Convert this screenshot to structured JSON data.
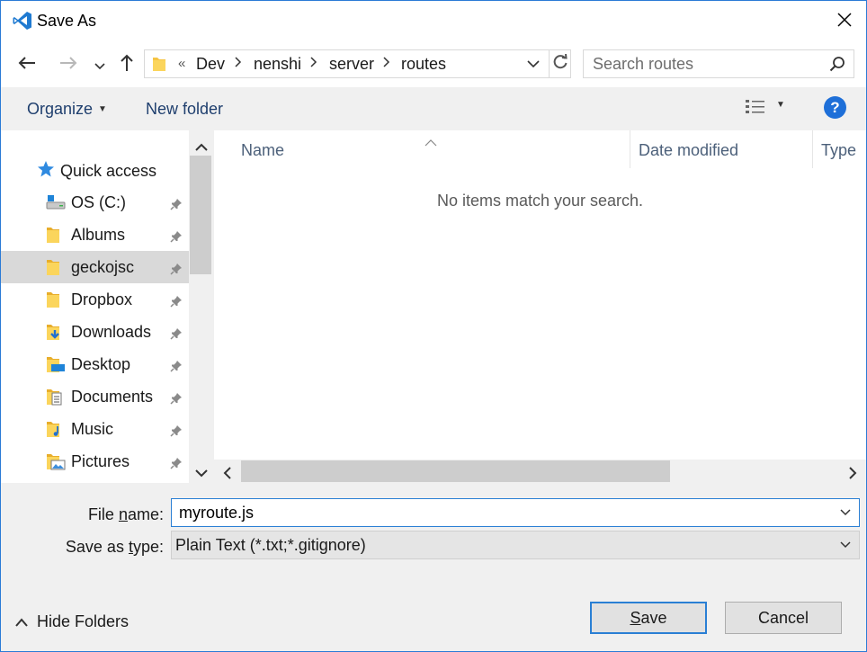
{
  "window": {
    "title": "Save As"
  },
  "icons": {
    "app": "vscode-icon",
    "close": "close-icon",
    "back": "back-arrow-icon",
    "forward": "forward-arrow-icon",
    "recent": "chevron-down-icon",
    "up": "up-arrow-icon",
    "refresh": "refresh-icon",
    "search": "search-icon",
    "help": "help-icon",
    "pin": "pin-icon"
  },
  "address": {
    "overflow": "«",
    "crumbs": [
      "Dev",
      "nenshi",
      "server",
      "routes"
    ]
  },
  "search": {
    "placeholder": "Search routes",
    "value": ""
  },
  "toolbar": {
    "organize": "Organize",
    "new_folder": "New folder",
    "help": "?"
  },
  "sidebar": {
    "quick_access": "Quick access",
    "items": [
      {
        "label": "OS (C:)",
        "icon": "drive-icon",
        "pinned": true
      },
      {
        "label": "Albums",
        "icon": "folder-icon",
        "pinned": true
      },
      {
        "label": "geckojsc",
        "icon": "folder-icon",
        "pinned": true,
        "selected": true
      },
      {
        "label": "Dropbox",
        "icon": "folder-icon",
        "pinned": true
      },
      {
        "label": "Downloads",
        "icon": "downloads-folder-icon",
        "pinned": true
      },
      {
        "label": "Desktop",
        "icon": "desktop-folder-icon",
        "pinned": true
      },
      {
        "label": "Documents",
        "icon": "documents-folder-icon",
        "pinned": true
      },
      {
        "label": "Music",
        "icon": "music-folder-icon",
        "pinned": true
      },
      {
        "label": "Pictures",
        "icon": "pictures-folder-icon",
        "pinned": true
      }
    ]
  },
  "filelist": {
    "columns": [
      "Name",
      "Date modified",
      "Type"
    ],
    "empty_message": "No items match your search."
  },
  "form": {
    "file_name_label_pre": "File ",
    "file_name_label_key": "n",
    "file_name_label_post": "ame:",
    "file_name_value": "myroute.js",
    "save_type_label_pre": "Save as ",
    "save_type_label_key": "t",
    "save_type_label_post": "ype:",
    "save_type_value": "Plain Text (*.txt;*.gitignore)"
  },
  "footer": {
    "hide_folders": "Hide Folders",
    "save_key": "S",
    "save_rest": "ave",
    "cancel": "Cancel"
  },
  "colors": {
    "accent": "#2a7fd4",
    "link": "#1f3f6e",
    "folder": "#f6c443",
    "selected": "#d9d9d9"
  }
}
